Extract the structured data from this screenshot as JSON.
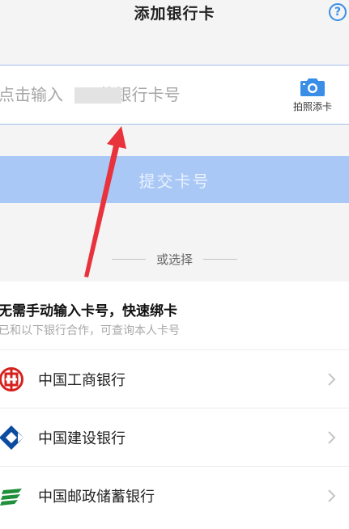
{
  "header": {
    "title": "添加银行卡",
    "help_label": "?"
  },
  "card_input": {
    "placeholder": "点击输入       的银行卡号",
    "value": ""
  },
  "photo_add": {
    "icon": "camera-icon",
    "label": "拍照添卡"
  },
  "submit": {
    "label": "提交卡号"
  },
  "divider": {
    "label": "或选择"
  },
  "quick_bind": {
    "title": "无需手动输入卡号，快速绑卡",
    "subtitle": "已和以下银行合作，可查询本人卡号",
    "banks": [
      {
        "name": "中国工商银行",
        "icon": "icbc-logo-icon",
        "color": "#d6221e"
      },
      {
        "name": "中国建设银行",
        "icon": "ccb-logo-icon",
        "color": "#0a4da0"
      },
      {
        "name": "中国邮政储蓄银行",
        "icon": "psbc-logo-icon",
        "color": "#1f8f3a"
      }
    ]
  },
  "colors": {
    "accent": "#3a8ee6",
    "submit_bg": "#a9c8f6",
    "annotation_arrow": "#e8323c"
  }
}
